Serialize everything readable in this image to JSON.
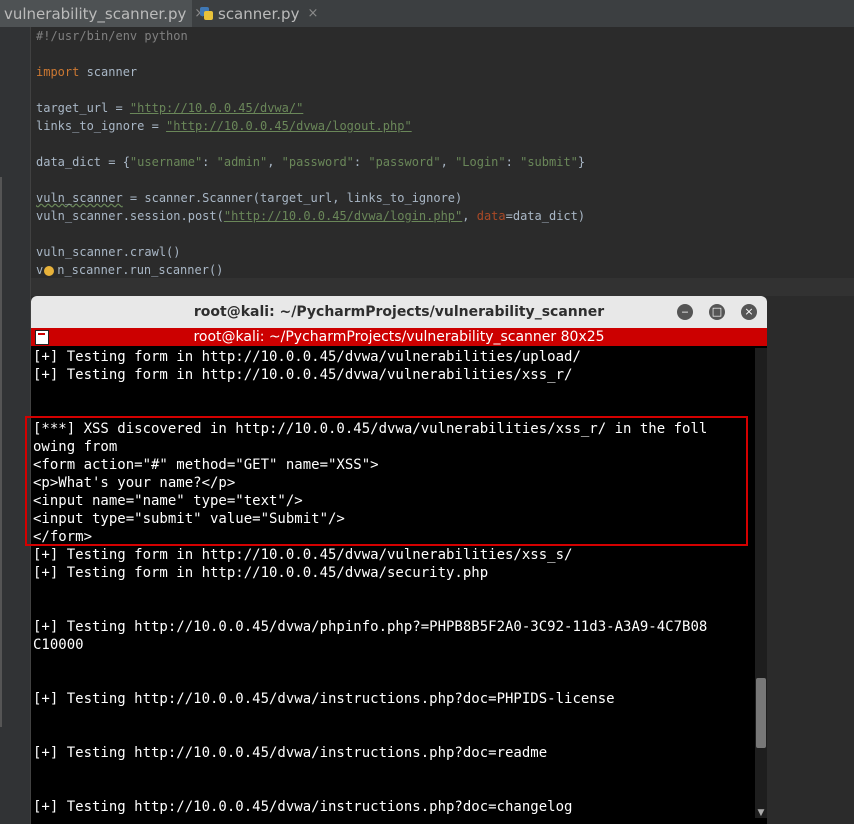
{
  "tabs": [
    {
      "label": "vulnerability_scanner.py",
      "close": "×"
    },
    {
      "label": "scanner.py",
      "close": "×"
    }
  ],
  "code": {
    "l1": "#!/usr/bin/env python",
    "import_kw": "import",
    "import_mod": " scanner",
    "target_lhs": "target_url = ",
    "target_url": "\"http://10.0.0.45/dvwa/\"",
    "links_lhs": "links_to_ignore = ",
    "links_url": "\"http://10.0.0.45/dvwa/logout.php\"",
    "dd_lhs": "data_dict = {",
    "dd_k1": "\"username\"",
    "dd_v1": "\"admin\"",
    "dd_k2": "\"password\"",
    "dd_v2": "\"password\"",
    "dd_k3": "\"Login\"",
    "dd_v3": "\"submit\"",
    "dd_end": "}",
    "vs_name": "vuln_scanner",
    "vs_rest": " = scanner.Scanner(target_url, links_to_ignore)",
    "post_lhs": "vuln_scanner.session.post(",
    "post_url": "\"http://10.0.0.45/dvwa/login.php\"",
    "post_sep": ", ",
    "post_param": "data",
    "post_rest": "=data_dict)",
    "crawl": "vuln_scanner.crawl()",
    "run_pre": "v",
    "run_rest": "n_scanner.run_scanner()"
  },
  "terminal": {
    "window_title": "root@kali: ~/PycharmProjects/vulnerability_scanner",
    "tab_title": "root@kali: ~/PycharmProjects/vulnerability_scanner 80x25",
    "btn_min": "‒",
    "btn_max": "□",
    "btn_close": "×",
    "lines": [
      "[+] Testing form in http://10.0.0.45/dvwa/vulnerabilities/upload/",
      "[+] Testing form in http://10.0.0.45/dvwa/vulnerabilities/xss_r/",
      "",
      "",
      "[***] XSS discovered in http://10.0.0.45/dvwa/vulnerabilities/xss_r/ in the foll",
      "owing from",
      "<form action=\"#\" method=\"GET\" name=\"XSS\">",
      "<p>What's your name?</p>",
      "<input name=\"name\" type=\"text\"/>",
      "<input type=\"submit\" value=\"Submit\"/>",
      "</form>",
      "[+] Testing form in http://10.0.0.45/dvwa/vulnerabilities/xss_s/",
      "[+] Testing form in http://10.0.0.45/dvwa/security.php",
      "",
      "",
      "[+] Testing http://10.0.0.45/dvwa/phpinfo.php?=PHPB8B5F2A0-3C92-11d3-A3A9-4C7B08",
      "C10000",
      "",
      "",
      "[+] Testing http://10.0.0.45/dvwa/instructions.php?doc=PHPIDS-license",
      "",
      "",
      "[+] Testing http://10.0.0.45/dvwa/instructions.php?doc=readme",
      "",
      "",
      "[+] Testing http://10.0.0.45/dvwa/instructions.php?doc=changelog"
    ]
  },
  "scroll_arrow": "▼"
}
